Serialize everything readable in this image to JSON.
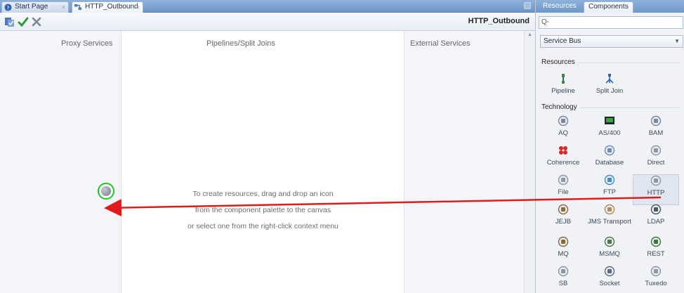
{
  "editor": {
    "tabs": [
      {
        "label": "Start Page"
      },
      {
        "label": "HTTP_Outbound"
      }
    ],
    "toolbar_title": "HTTP_Outbound",
    "columns": {
      "proxy": "Proxy Services",
      "pipelines": "Pipelines/Split Joins",
      "external": "External Services"
    },
    "hint_lines": [
      "To create resources, drag and drop an icon",
      "from the component palette to the canvas",
      "or select one from the right-click context menu"
    ]
  },
  "palette": {
    "tabs": [
      {
        "label": "Resources"
      },
      {
        "label": "Components"
      }
    ],
    "search_placeholder": "",
    "search_prefix": "Q-",
    "selected_category": "Service Bus",
    "sections": {
      "resources": "Resources",
      "technology": "Technology"
    },
    "resource_items": [
      {
        "label": "Pipeline",
        "icon": "pipeline-icon"
      },
      {
        "label": "Split Join",
        "icon": "split-join-icon"
      }
    ],
    "technology_items": [
      {
        "label": "AQ",
        "icon": "aq-icon"
      },
      {
        "label": "AS/400",
        "icon": "as400-icon"
      },
      {
        "label": "BAM",
        "icon": "bam-icon"
      },
      {
        "label": "Coherence",
        "icon": "coherence-icon"
      },
      {
        "label": "Database",
        "icon": "database-icon"
      },
      {
        "label": "Direct",
        "icon": "direct-icon"
      },
      {
        "label": "File",
        "icon": "file-icon"
      },
      {
        "label": "FTP",
        "icon": "ftp-icon"
      },
      {
        "label": "HTTP",
        "icon": "http-icon"
      },
      {
        "label": "JEJB",
        "icon": "jejb-icon"
      },
      {
        "label": "JMS Transport",
        "icon": "jms-icon"
      },
      {
        "label": "LDAP",
        "icon": "ldap-icon"
      },
      {
        "label": "MQ",
        "icon": "mq-icon"
      },
      {
        "label": "MSMQ",
        "icon": "msmq-icon"
      },
      {
        "label": "REST",
        "icon": "rest-icon"
      },
      {
        "label": "SB",
        "icon": "sb-icon"
      },
      {
        "label": "Socket",
        "icon": "socket-icon"
      },
      {
        "label": "Tuxedo",
        "icon": "tuxedo-icon"
      }
    ]
  },
  "colors": {
    "drag_arrow": "#e01b1b",
    "drop_target_ring": "#18cc18",
    "tab_bar": "#7ea3d3"
  }
}
